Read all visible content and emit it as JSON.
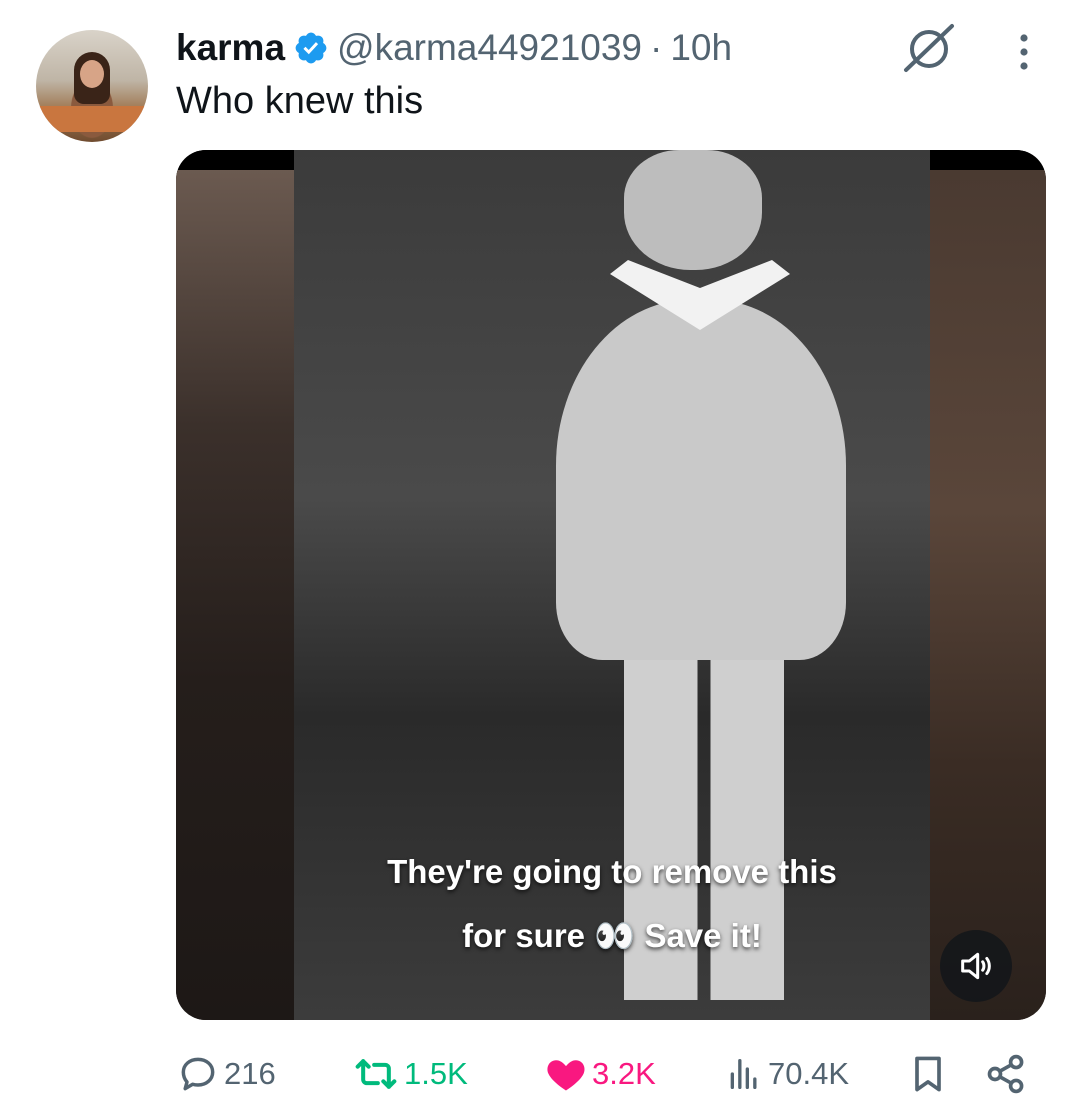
{
  "post": {
    "display_name": "karma",
    "handle": "@karma44921039",
    "separator": "·",
    "time": "10h",
    "text": "Who knew this"
  },
  "media": {
    "caption_line1": "They're going to remove this",
    "caption_line2": "for sure 👀 Save it!"
  },
  "actions": {
    "replies": "216",
    "reposts": "1.5K",
    "likes": "3.2K",
    "views": "70.4K"
  },
  "icons": {
    "verified": "verified-badge-icon",
    "grok": "grok-icon",
    "more": "more-vertical-icon",
    "mute": "volume-icon",
    "reply": "reply-icon",
    "repost": "repost-icon",
    "like": "heart-icon",
    "views": "views-icon",
    "bookmark": "bookmark-icon",
    "share": "share-icon"
  },
  "colors": {
    "verified": "#1d9bf0",
    "repost": "#00ba7c",
    "like": "#f91880",
    "muted_text": "#536471"
  }
}
